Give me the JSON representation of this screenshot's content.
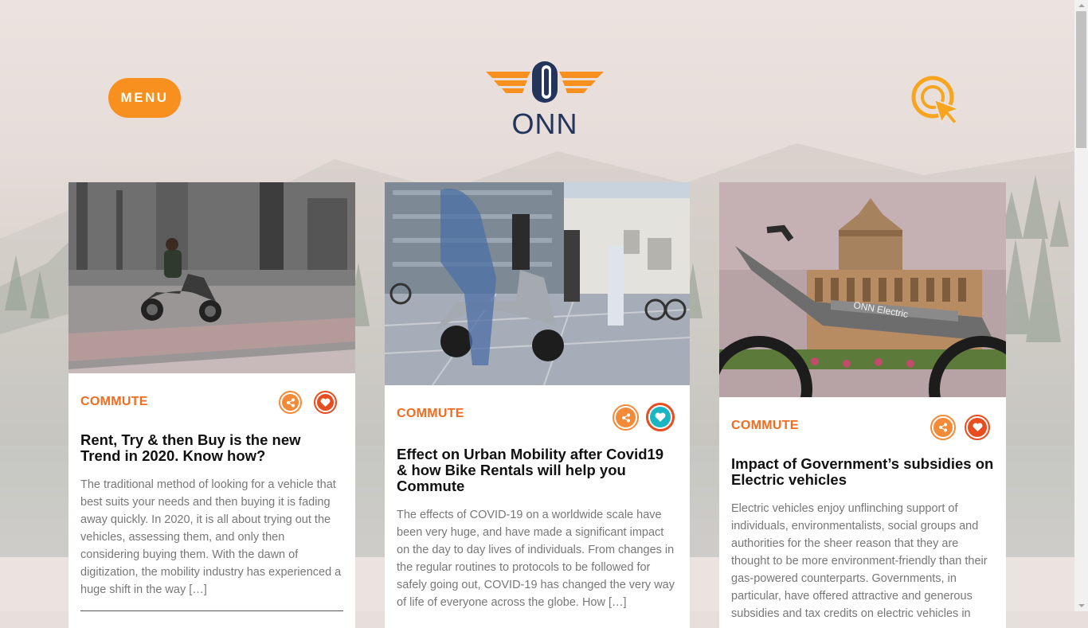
{
  "header": {
    "menu_label": "MENU",
    "logo_text": "ONN",
    "search_icon": "search-pointer-icon"
  },
  "colors": {
    "accent": "#f7901e",
    "category": "#f06c1f",
    "logo_navy": "#23355b",
    "like_active": "#19b5c2"
  },
  "posts": [
    {
      "category": "COMMUTE",
      "title": "Rent, Try & then Buy is the new Trend in 2020. Know how?",
      "excerpt": "The traditional method of looking for a vehicle that best suits your needs and then buying it is fading away quickly. In 2020, it is all about trying out the vehicles, assessing them, and only then considering buying them. With the dawn of digitization, the mobility industry has experienced a huge shift in the way […]",
      "liked": false
    },
    {
      "category": "COMMUTE",
      "title": "Effect on Urban Mobility after Covid19 & how Bike Rentals will help you Commute",
      "excerpt": "The effects of COVID-19 on a worldwide scale have been very huge, and have made a significant impact on the day to day lives of individuals. From changes in the regular routines to protocols to be followed for safely going out, COVID-19 has changed the very way of life of everyone across the globe. How […]",
      "liked": true
    },
    {
      "category": "COMMUTE",
      "title": "Impact of Government’s subsidies on Electric vehicles",
      "excerpt": "Electric vehicles enjoy unflinching support of individuals, environmentalists, social groups and authorities for the sheer reason that they are thought to be more environment-friendly than their gas-powered counterparts. Governments, in particular, have offered attractive and generous subsidies and tax credits on electric vehicles in",
      "image_text": "ONN Electric",
      "liked": false
    }
  ]
}
